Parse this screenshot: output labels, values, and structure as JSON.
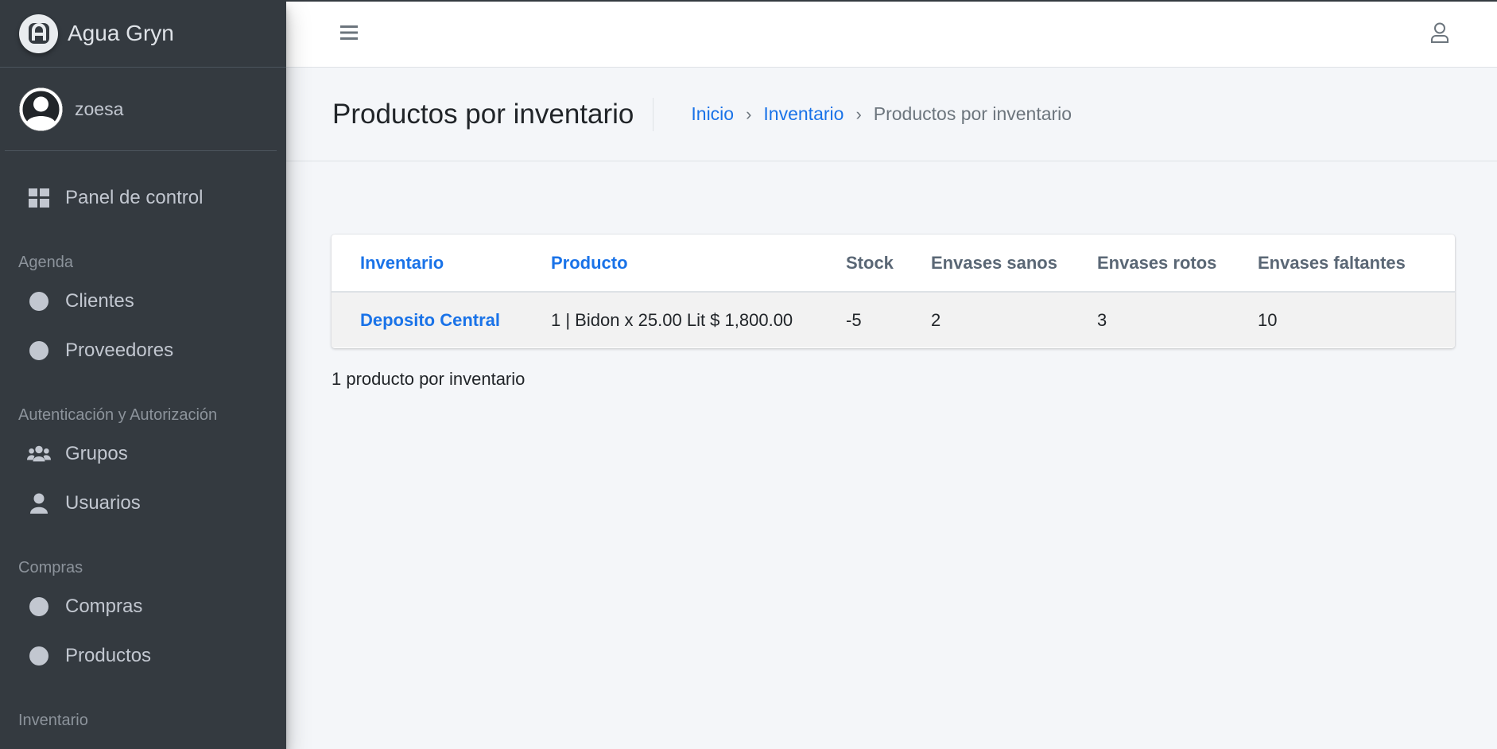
{
  "brand": {
    "name": "Agua Gryn"
  },
  "user": {
    "name": "zoesa"
  },
  "sidebar": {
    "dashboard_label": "Panel de control",
    "sections": {
      "agenda": "Agenda",
      "auth": "Autenticación y Autorización",
      "compras": "Compras",
      "inventario": "Inventario"
    },
    "items": {
      "clientes": "Clientes",
      "proveedores": "Proveedores",
      "grupos": "Grupos",
      "usuarios": "Usuarios",
      "compras": "Compras",
      "productos": "Productos"
    }
  },
  "header": {
    "page_title": "Productos por inventario",
    "breadcrumb": [
      "Inicio",
      "Inventario",
      "Productos por inventario"
    ],
    "breadcrumb_separator": "›"
  },
  "table": {
    "columns": [
      "Inventario",
      "Producto",
      "Stock",
      "Envases sanos",
      "Envases rotos",
      "Envases faltantes"
    ],
    "rows": [
      {
        "inventario": "Deposito Central",
        "producto": "1 | Bidon x 25.00 Lit $ 1,800.00",
        "stock": "-5",
        "envases_sanos": "2",
        "envases_rotos": "3",
        "envases_faltantes": "10"
      }
    ]
  },
  "result_count": "1 producto por inventario",
  "colors": {
    "sidebar_bg": "#343a40",
    "link": "#1a73e8",
    "content_bg": "#f4f6f9"
  }
}
